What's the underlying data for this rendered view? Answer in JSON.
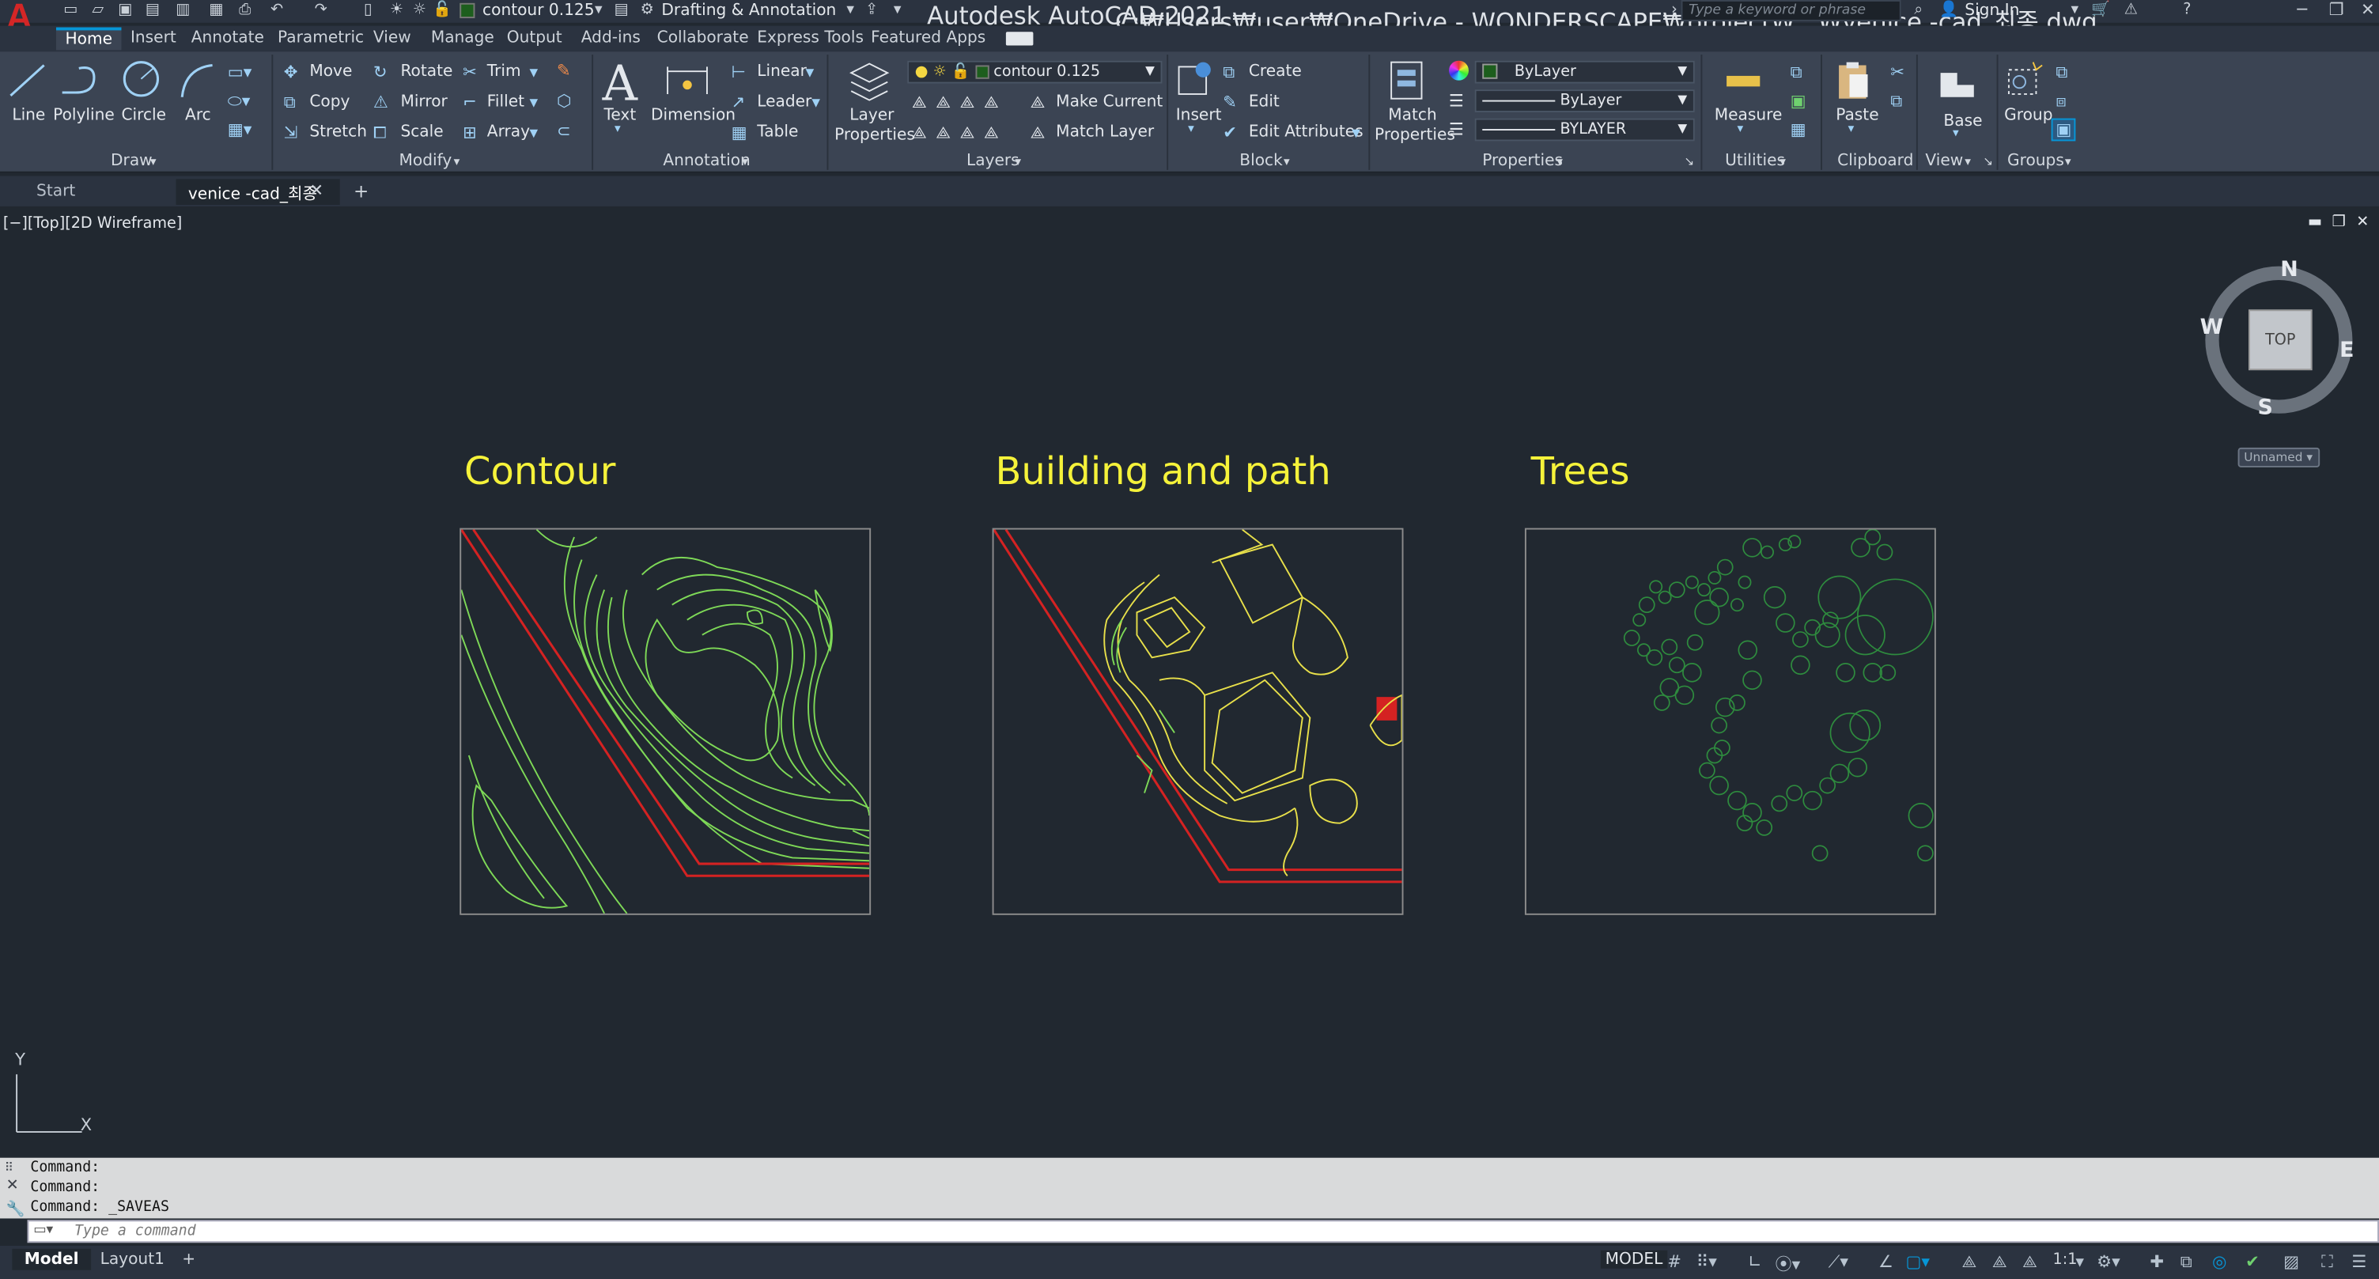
{
  "app": {
    "logo": "A",
    "title": "Autodesk AutoCAD 2021",
    "path": "C:₩Users₩user₩OneDrive - WONDERSCAPE₩project₩...₩venice -cad_최종.dwg",
    "search_placeholder": "Type a keyword or phrase",
    "sign_in": "Sign In",
    "quick_layer": "contour 0.125",
    "workspace": "Drafting & Annotation"
  },
  "ribbon_tabs": [
    "Home",
    "Insert",
    "Annotate",
    "Parametric",
    "View",
    "Manage",
    "Output",
    "Add-ins",
    "Collaborate",
    "Express Tools",
    "Featured Apps"
  ],
  "draw": {
    "title": "Draw",
    "line": "Line",
    "polyline": "Polyline",
    "circle": "Circle",
    "arc": "Arc"
  },
  "modify": {
    "title": "Modify",
    "move": "Move",
    "rotate": "Rotate",
    "trim": "Trim",
    "copy": "Copy",
    "mirror": "Mirror",
    "fillet": "Fillet",
    "stretch": "Stretch",
    "scale": "Scale",
    "array": "Array"
  },
  "annotation": {
    "title": "Annotation",
    "text": "Text",
    "dimension": "Dimension",
    "linear": "Linear",
    "leader": "Leader",
    "table": "Table"
  },
  "layers": {
    "title": "Layers",
    "layer_properties_1": "Layer",
    "layer_properties_2": "Properties",
    "current_layer": "contour 0.125",
    "make_current": "Make Current",
    "match_layer": "Match Layer"
  },
  "block": {
    "title": "Block",
    "insert": "Insert",
    "create": "Create",
    "edit": "Edit",
    "edit_attributes": "Edit Attributes"
  },
  "properties": {
    "title": "Properties",
    "match_1": "Match",
    "match_2": "Properties",
    "color": "ByLayer",
    "linetype": "ByLayer",
    "lineweight": "BYLAYER"
  },
  "utilities": {
    "title": "Utilities",
    "measure": "Measure"
  },
  "clipboard": {
    "title": "Clipboard",
    "paste": "Paste"
  },
  "view": {
    "title": "View",
    "base": "Base"
  },
  "groups": {
    "title": "Groups",
    "group": "Group"
  },
  "doc_tabs": [
    "Start",
    "venice -cad_최종"
  ],
  "viewport_label": "[−][Top][2D Wireframe]",
  "viewcube": {
    "top": "TOP",
    "n": "N",
    "s": "S",
    "e": "E",
    "w": "W",
    "ucs": "Unnamed"
  },
  "sheets": [
    {
      "title": "Contour"
    },
    {
      "title": "Building and path"
    },
    {
      "title": "Trees"
    }
  ],
  "ucs_axes": {
    "x": "X",
    "y": "Y"
  },
  "command": {
    "history": [
      "Command:",
      "Command:",
      "Command:  _SAVEAS"
    ],
    "placeholder": "Type a command"
  },
  "layout_tabs": [
    "Model",
    "Layout1"
  ],
  "status": {
    "model": "MODEL",
    "scale": "1:1"
  },
  "colors": {
    "contour": "#7ed957",
    "building": "#e8e04a",
    "road": "#d42222",
    "trees": "#2e8b3e",
    "title": "#f5f23a",
    "accent": "#0696d7"
  }
}
